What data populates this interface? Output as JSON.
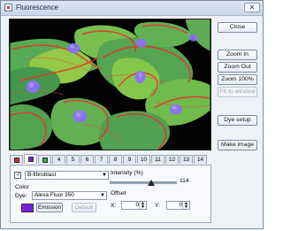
{
  "window": {
    "title": "Fluorescence",
    "close_glyph": "✕"
  },
  "sidebar": {
    "close": "Close",
    "zoom_in": "Zoom In",
    "zoom_out": "Zoom Out",
    "zoom_100": "Zoom 100%",
    "fit_to_window": "Fit to window",
    "dye_setup": "Dye setup",
    "make_image": "Make image"
  },
  "tabs": [
    {
      "label": "",
      "swatch": "#d72a2a",
      "active": false
    },
    {
      "label": "",
      "swatch": "#7a1fe0",
      "active": true
    },
    {
      "label": "",
      "swatch": "#28b44a",
      "active": false
    },
    {
      "label": "4"
    },
    {
      "label": "5"
    },
    {
      "label": "6"
    },
    {
      "label": "7"
    },
    {
      "label": "8"
    },
    {
      "label": "9"
    },
    {
      "label": "10"
    },
    {
      "label": "11"
    },
    {
      "label": "12"
    },
    {
      "label": "13"
    },
    {
      "label": "14"
    }
  ],
  "panel": {
    "enabled_check": "✓",
    "channel": "B-fibroblast",
    "color_label": "Color",
    "dye_label": "Dye:",
    "dye": "Alexa Fluor 350",
    "emission": "Emission",
    "default": "Default",
    "intensity_label": "Intensity (%)",
    "intensity_value": "114",
    "intensity_fraction": 0.62,
    "offset_label": "Offset",
    "x_label": "X:",
    "x_value": "0",
    "y_label": "Y:",
    "y_value": "0",
    "color": "#7b1fe0"
  }
}
